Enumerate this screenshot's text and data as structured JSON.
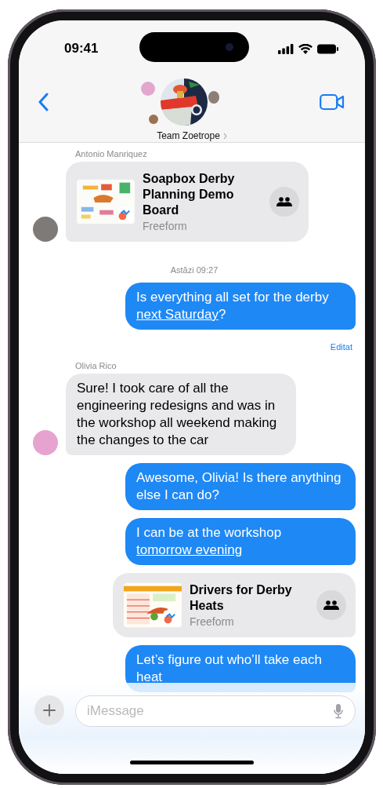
{
  "status_bar": {
    "time": "09:41"
  },
  "header": {
    "title": "Team Zoetrope"
  },
  "messages": [
    {
      "kind": "sender",
      "text": "Antonio Manriquez"
    },
    {
      "kind": "card",
      "outgoing": false,
      "avatar": true,
      "color": "#7d7a78",
      "title": "Soapbox Derby Planning Demo Board",
      "app": "Freeform"
    },
    {
      "kind": "timestamp",
      "text": "Astăzi 09:27"
    },
    {
      "kind": "text",
      "outgoing": true,
      "parts": [
        {
          "text": "Is everything all set for the derby "
        },
        {
          "text": "next Saturday",
          "kind": "link"
        },
        {
          "text": "?"
        }
      ]
    },
    {
      "kind": "status",
      "text": "Editat"
    },
    {
      "kind": "sender",
      "text": "Olivia Rico"
    },
    {
      "kind": "text",
      "outgoing": false,
      "avatar": true,
      "color": "#e7a3cf",
      "parts": [
        {
          "text": "Sure! I took care of all the engineering redesigns and was in the workshop all weekend making the changes to the car"
        }
      ]
    },
    {
      "kind": "text",
      "outgoing": true,
      "parts": [
        {
          "text": "Awesome, Olivia! Is there anything else I can do?"
        }
      ]
    },
    {
      "kind": "text",
      "outgoing": true,
      "parts": [
        {
          "text": "I can be at the workshop "
        },
        {
          "text": "tomorrow evening",
          "kind": "link"
        }
      ]
    },
    {
      "kind": "card",
      "outgoing": true,
      "title": "Drivers for Derby Heats",
      "app": "Freeform"
    },
    {
      "kind": "text",
      "outgoing": true,
      "parts": [
        {
          "text": "Let’s figure out who’ll take each heat"
        }
      ]
    }
  ],
  "composer": {
    "placeholder": "iMessage"
  }
}
